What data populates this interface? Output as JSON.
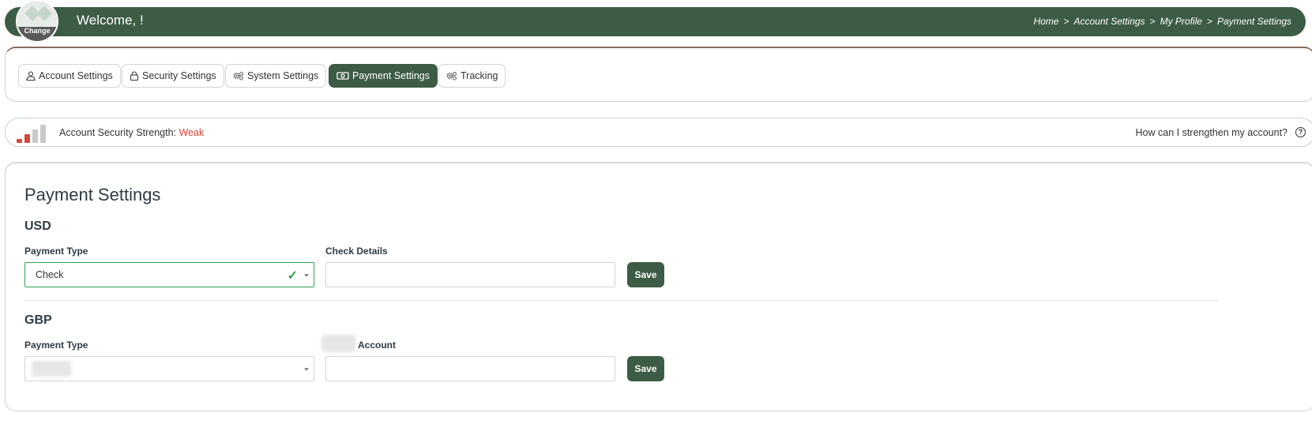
{
  "header": {
    "avatar_label": "Change",
    "welcome": "Welcome, !",
    "breadcrumbs": [
      "Home",
      "Account Settings",
      "My Profile",
      "Payment Settings"
    ],
    "separator": ">"
  },
  "tabs": [
    {
      "label": "Account Settings",
      "icon": "user-icon",
      "active": false
    },
    {
      "label": "Security Settings",
      "icon": "lock-icon",
      "active": false
    },
    {
      "label": "System Settings",
      "icon": "gears-icon",
      "active": false
    },
    {
      "label": "Payment Settings",
      "icon": "money-icon",
      "active": true
    },
    {
      "label": "Tracking",
      "icon": "gears-icon",
      "active": false
    }
  ],
  "strength": {
    "label": "Account Security Strength:",
    "value": "Weak",
    "level": 2,
    "max_level": 4,
    "help_text": "How can I strengthen my account?",
    "help_icon": "question-circle-icon"
  },
  "main": {
    "title": "Payment Settings",
    "sections": [
      {
        "currency": "USD",
        "payment_type_label": "Payment Type",
        "payment_type_value": "Check",
        "details_label": "Check Details",
        "details_value": "",
        "save_label": "Save"
      },
      {
        "currency": "GBP",
        "payment_type_label": "Payment Type",
        "payment_type_value": "",
        "details_label": "Account",
        "details_value": "",
        "save_label": "Save"
      }
    ]
  },
  "colors": {
    "brand": "#3d5c45",
    "weak": "#d9473a",
    "valid": "#2ea44f"
  }
}
